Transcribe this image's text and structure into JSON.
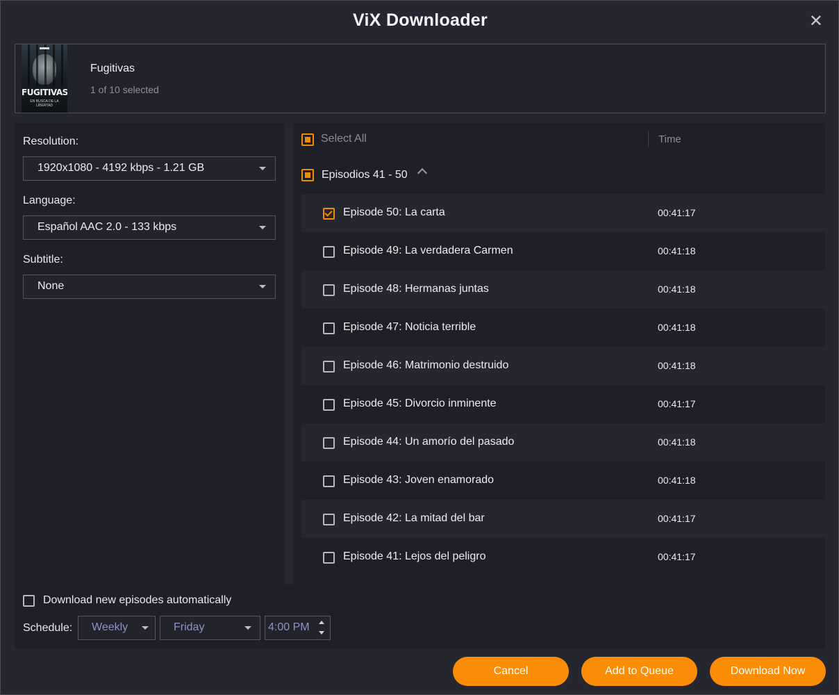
{
  "window": {
    "title": "ViX Downloader",
    "close_glyph": "✕"
  },
  "show": {
    "poster_title": "FUGITIVAS",
    "poster_subtitle": "EN BUSCA DE LA LIBERTAD",
    "title": "Fugitivas",
    "selection_status": "1 of 10 selected"
  },
  "settings": {
    "resolution_label": "Resolution:",
    "resolution_value": "1920x1080 - 4192 kbps - 1.21 GB",
    "language_label": "Language:",
    "language_value": "Español AAC 2.0 - 133 kbps",
    "subtitle_label": "Subtitle:",
    "subtitle_value": "None"
  },
  "episode_list": {
    "select_all_label": "Select All",
    "time_header": "Time",
    "group_label": "Episodios 41 - 50",
    "episodes": [
      {
        "title": "Episode 50: La carta",
        "time": "00:41:17",
        "checked": true
      },
      {
        "title": "Episode 49: La verdadera Carmen",
        "time": "00:41:18",
        "checked": false
      },
      {
        "title": "Episode 48: Hermanas juntas",
        "time": "00:41:18",
        "checked": false
      },
      {
        "title": "Episode 47: Noticia terrible",
        "time": "00:41:18",
        "checked": false
      },
      {
        "title": "Episode 46: Matrimonio destruido",
        "time": "00:41:18",
        "checked": false
      },
      {
        "title": "Episode 45: Divorcio inminente",
        "time": "00:41:17",
        "checked": false
      },
      {
        "title": "Episode 44: Un amorío del pasado",
        "time": "00:41:18",
        "checked": false
      },
      {
        "title": "Episode 43: Joven enamorado",
        "time": "00:41:18",
        "checked": false
      },
      {
        "title": "Episode 42: La mitad del bar",
        "time": "00:41:17",
        "checked": false
      },
      {
        "title": "Episode 41: Lejos del peligro",
        "time": "00:41:17",
        "checked": false
      }
    ]
  },
  "auto_download": {
    "label": "Download new episodes automatically",
    "checked": false,
    "schedule_label": "Schedule:",
    "frequency": "Weekly",
    "day": "Friday",
    "time": "4:00 PM"
  },
  "buttons": {
    "cancel": "Cancel",
    "add_to_queue": "Add to Queue",
    "download_now": "Download Now"
  },
  "colors": {
    "accent": "#fb8c06",
    "background": "#262630",
    "panel": "#1f1f27"
  }
}
